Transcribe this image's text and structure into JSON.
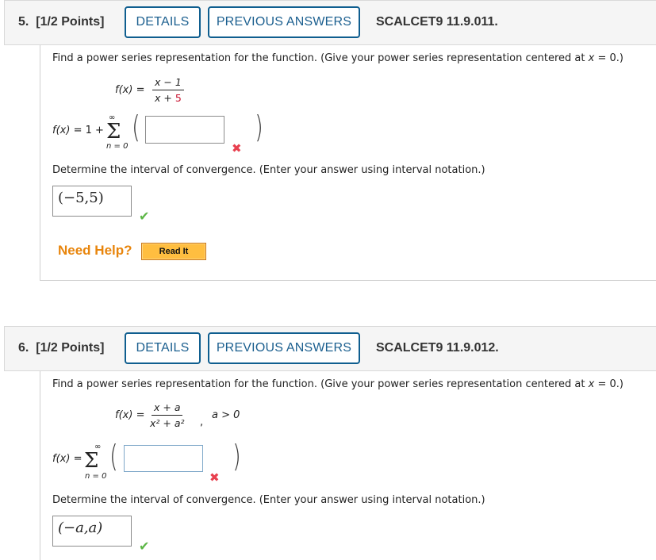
{
  "questions": [
    {
      "number": "5.",
      "points": "[1/2 Points]",
      "details_label": "DETAILS",
      "previous_answers_label": "PREVIOUS ANSWERS",
      "reference": "SCALCET9 11.9.011.",
      "prompt": "Find a power series representation for the function. (Give your power series representation centered at ",
      "prompt_var": "x",
      "prompt_end": " = 0.)",
      "function": {
        "lhs": "f(x)",
        "equals": "=",
        "numerator": "x − 1",
        "denominator_prefix": "x + ",
        "denominator_highlight": "5",
        "condition": ""
      },
      "series": {
        "lhs": "f(x)",
        "equals_prefix": "= 1 +",
        "upper_limit": "∞",
        "lower_limit": "n = 0",
        "sigma": "Σ",
        "term_input_value": "",
        "term_status": "incorrect"
      },
      "interval_prompt": "Determine the interval of convergence. (Enter your answer using interval notation.)",
      "interval_answer": "(−5,5)",
      "interval_status": "correct",
      "need_help_label": "Need Help?",
      "read_it_label": "Read It"
    },
    {
      "number": "6.",
      "points": "[1/2 Points]",
      "details_label": "DETAILS",
      "previous_answers_label": "PREVIOUS ANSWERS",
      "reference": "SCALCET9 11.9.012.",
      "prompt": "Find a power series representation for the function. (Give your power series representation centered at ",
      "prompt_var": "x",
      "prompt_end": " = 0.)",
      "function": {
        "lhs": "f(x)",
        "equals": "=",
        "numerator": "x + a",
        "denominator": "x² + a²",
        "trailing": ",",
        "condition": "a > 0"
      },
      "series": {
        "lhs": "f(x)",
        "equals_prefix": "=",
        "upper_limit": "∞",
        "lower_limit": "n = 0",
        "sigma": "Σ",
        "term_input_value": "",
        "term_status": "incorrect"
      },
      "interval_prompt": "Determine the interval of convergence. (Enter your answer using interval notation.)",
      "interval_answer": "(−a,a)",
      "interval_status": "correct"
    }
  ],
  "icons": {
    "incorrect": "✖",
    "correct": "✔"
  },
  "colors": {
    "button_border": "#0f5e8f",
    "need_help": "#e8850c",
    "read_it_bg": "#ffbe40",
    "incorrect": "#e8404f",
    "correct": "#5cb646",
    "highlight": "#c8102e"
  }
}
